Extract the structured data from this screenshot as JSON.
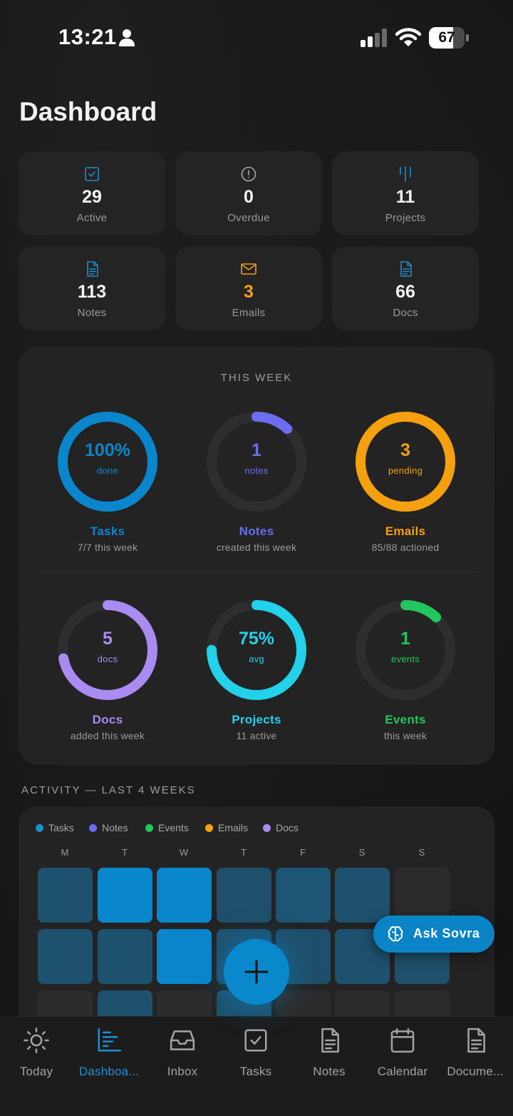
{
  "status_bar": {
    "time": "13:21",
    "battery": "67",
    "battery_level": 0.67
  },
  "page_title": "Dashboard",
  "stats": [
    {
      "value": "29",
      "label": "Active",
      "icon": "checkbox-icon",
      "color": "#f4f4f4"
    },
    {
      "value": "0",
      "label": "Overdue",
      "icon": "alert-circle-icon",
      "color": "#f4f4f4"
    },
    {
      "value": "11",
      "label": "Projects",
      "icon": "columns-icon",
      "color": "#f4f4f4"
    },
    {
      "value": "113",
      "label": "Notes",
      "icon": "document-icon",
      "color": "#f4f4f4"
    },
    {
      "value": "3",
      "label": "Emails",
      "icon": "mail-icon",
      "color": "#f5a00f"
    },
    {
      "value": "66",
      "label": "Docs",
      "icon": "document-icon",
      "color": "#f4f4f4"
    }
  ],
  "this_week": {
    "title": "THIS WEEK",
    "rings": [
      {
        "value": "100%",
        "sub": "done",
        "name": "Tasks",
        "desc": "7/7 this week",
        "color": "#0a86cc",
        "progress": 1.0
      },
      {
        "value": "1",
        "sub": "notes",
        "name": "Notes",
        "desc": "created this week",
        "color": "#6b6ef0",
        "progress": 0.12
      },
      {
        "value": "3",
        "sub": "pending",
        "name": "Emails",
        "desc": "85/88 actioned",
        "color": "#f5a00f",
        "progress": 0.99
      },
      {
        "value": "5",
        "sub": "docs",
        "name": "Docs",
        "desc": "added this week",
        "color": "#a98bf2",
        "progress": 0.72
      },
      {
        "value": "75%",
        "sub": "avg",
        "name": "Projects",
        "desc": "11 active",
        "color": "#22d1ea",
        "progress": 0.75
      },
      {
        "value": "1",
        "sub": "events",
        "name": "Events",
        "desc": "this week",
        "color": "#22c55e",
        "progress": 0.12
      }
    ]
  },
  "activity": {
    "title": "ACTIVITY — LAST 4 WEEKS",
    "legend": [
      {
        "label": "Tasks",
        "color": "#1a8ed0"
      },
      {
        "label": "Notes",
        "color": "#6b6ef0"
      },
      {
        "label": "Events",
        "color": "#22c55e"
      },
      {
        "label": "Emails",
        "color": "#f5a00f"
      },
      {
        "label": "Docs",
        "color": "#a98bf2"
      }
    ],
    "days": [
      "M",
      "T",
      "W",
      "T",
      "F",
      "S",
      "S"
    ],
    "grid": [
      [
        0.35,
        1.0,
        1.0,
        0.3,
        0.45,
        0.35,
        0.0
      ],
      [
        0.35,
        0.35,
        1.0,
        0.35,
        0.3,
        0.35,
        0.3
      ],
      [
        0.0,
        0.35,
        0.0,
        0.35,
        0.0,
        0.0,
        0.0
      ]
    ]
  },
  "ask_button": {
    "label": "Ask Sovra"
  },
  "tabs": [
    {
      "label": "Today",
      "icon": "sun-icon",
      "active": false
    },
    {
      "label": "Dashboa...",
      "icon": "bar-chart-icon",
      "active": true
    },
    {
      "label": "Inbox",
      "icon": "inbox-icon",
      "active": false
    },
    {
      "label": "Tasks",
      "icon": "checkbox-icon",
      "active": false
    },
    {
      "label": "Notes",
      "icon": "document-icon",
      "active": false
    },
    {
      "label": "Calendar",
      "icon": "calendar-icon",
      "active": false
    },
    {
      "label": "Docume...",
      "icon": "document-icon",
      "active": false
    }
  ]
}
